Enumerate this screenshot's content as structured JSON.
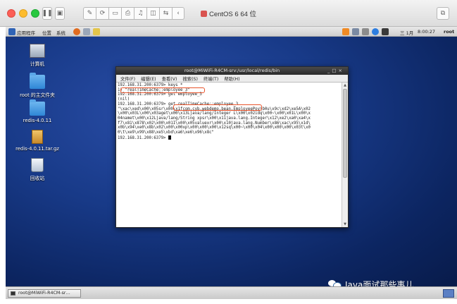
{
  "vm": {
    "title": "CentOS 6 64 位"
  },
  "top_panel": {
    "menu_apps": "应用程序",
    "menu_places": "位置",
    "menu_system": "系统",
    "date": "三 1月",
    "time": "8:00:27",
    "user": "root"
  },
  "desktop": {
    "icons": [
      {
        "label": "计算机"
      },
      {
        "label": "root 的主文件夹"
      },
      {
        "label": "redis-4.0.11"
      },
      {
        "label": "redis-4.0.11.tar.gz"
      },
      {
        "label": "回收站"
      }
    ]
  },
  "terminal": {
    "title": "root@MiWiFi-R4CM-srv:/usr/local/redis/bin",
    "menu": [
      "文件(F)",
      "编辑(E)",
      "查看(V)",
      "搜索(S)",
      "终端(T)",
      "帮助(H)"
    ],
    "lines": [
      "192.168.31.200:6379> keys *",
      "1) \"realTimeCache::employee_3\"",
      "192.168.31.200:6379> get employee_3",
      "(nil)",
      "192.168.31.200:6379> get realTimeCache::employee_3",
      "\"\\xac\\xed\\x00\\x05sr\\x00\\x1fcom.cyb.webdemo.bean.EmployeePoy\\b0u\\x9c\\xd2\\xe5A\\x02",
      "\\x00\\x03L\\x00\\x03aget\\x00\\x13Ljava/lang/Integer L\\x00\\x02idq\\x00~\\x00\\x01L\\x00\\x",
      "04namet\\x00\\x12Ljava/lang/String xpsr\\x00\\x11java.lang.Integer\\x12\\xe2\\xa0\\xa4\\x",
      "f7\\x81\\x878\\x02\\x00\\x01I\\x00\\x05valuexr\\x00\\x10java.lang.Number\\x86\\xac\\x95\\x1d\\",
      "x0b\\x94\\xe0\\x8b\\x02\\x00\\x00xp\\x00\\x00\\x00\\x12sq\\x00~\\x00\\x04\\x00\\x00\\x00\\x03t\\x0",
      "0\\t\\xe9\\x99\\x88\\xe5\\xbd\\xa6\\xe6\\x96\\x8c\"",
      "192.168.31.200:6379> "
    ]
  },
  "taskbar": {
    "item": "root@MiWiFi-R4CM-sr…"
  },
  "watermark": {
    "text": "Java面试那些事儿"
  }
}
